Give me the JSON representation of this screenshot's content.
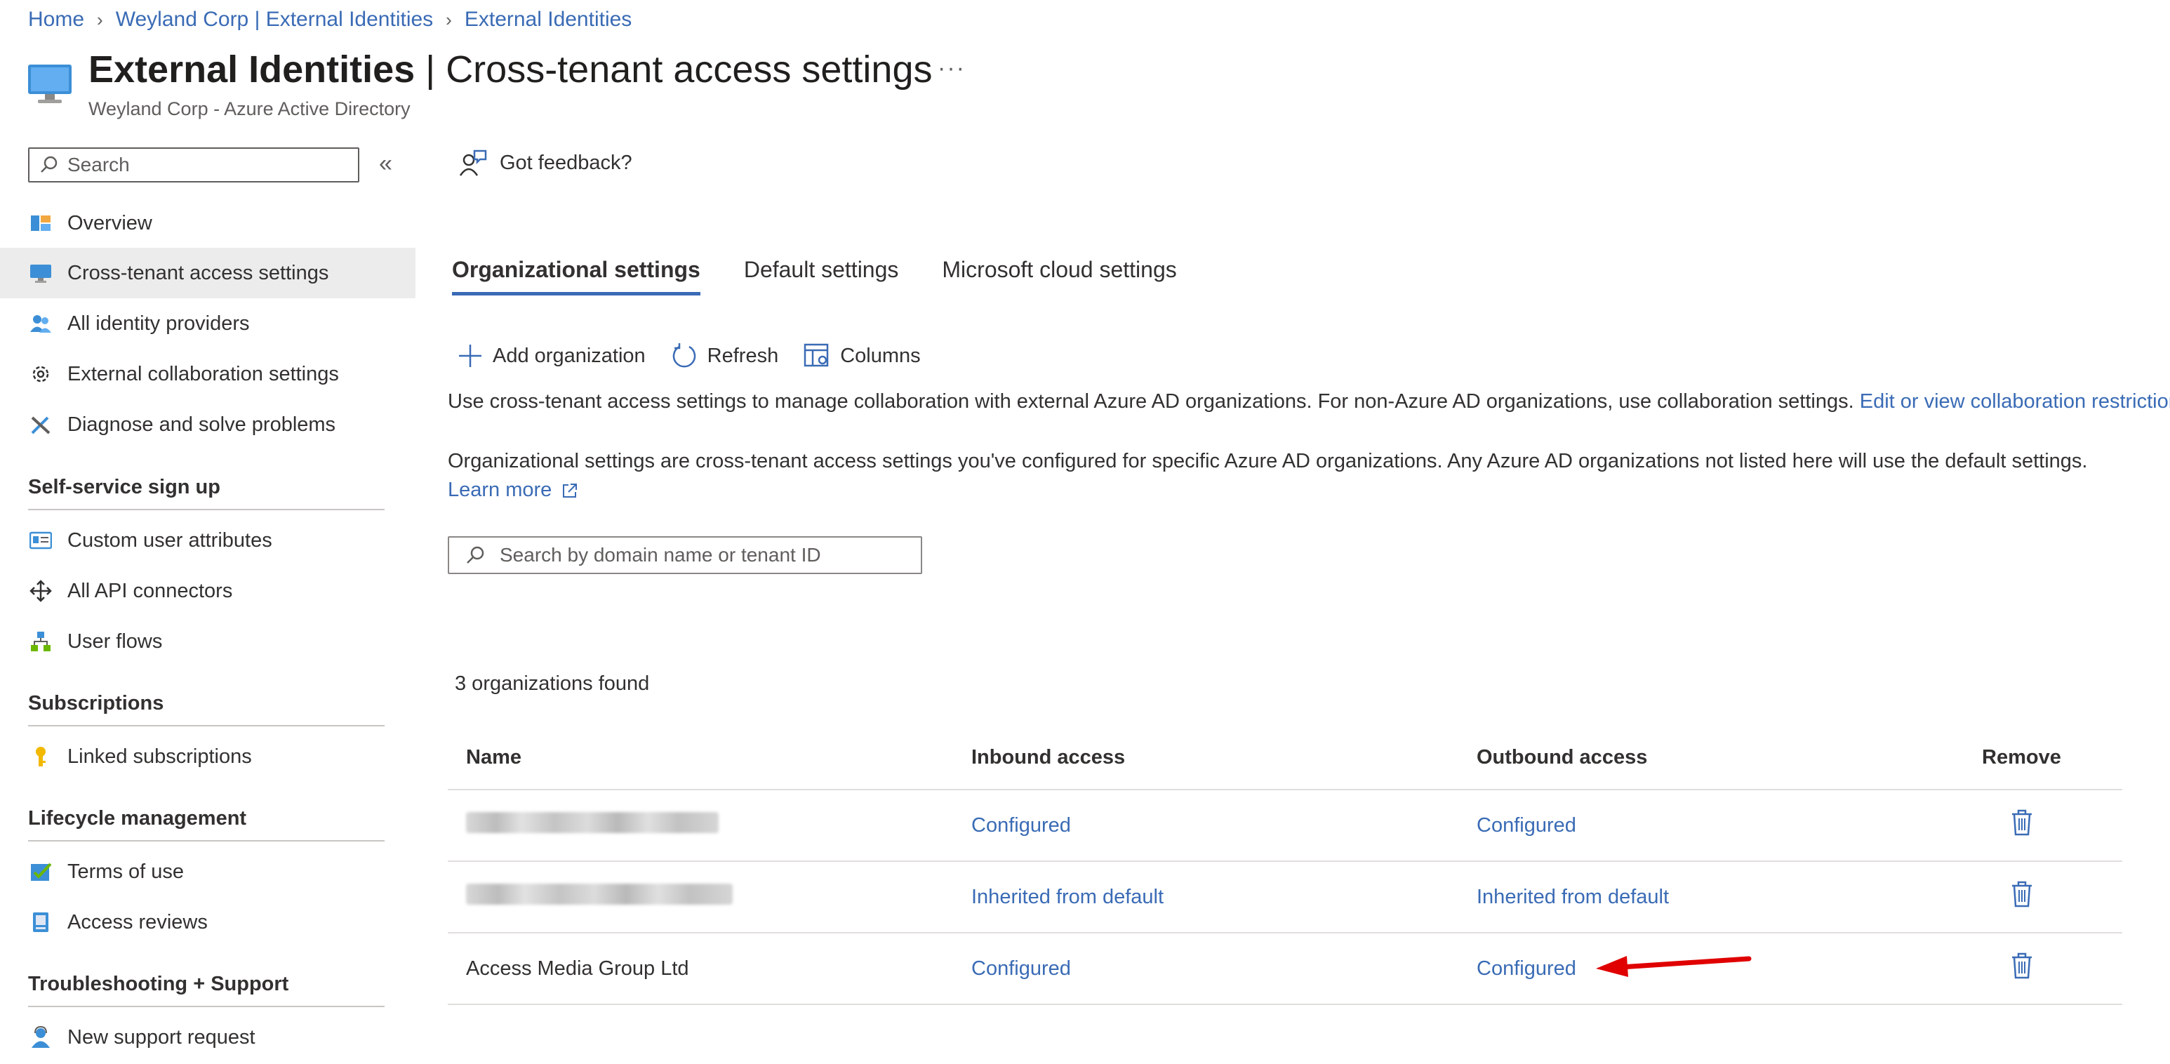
{
  "breadcrumb": {
    "items": [
      "Home",
      "Weyland Corp | External Identities",
      "External Identities"
    ]
  },
  "header": {
    "title_bold": "External Identities",
    "title_rest": " | Cross-tenant access settings",
    "more": "···",
    "subtitle": "Weyland Corp - Azure Active Directory"
  },
  "sidebar": {
    "search_placeholder": "Search",
    "collapse": "«",
    "items": [
      {
        "label": "Overview",
        "icon": "overview-icon"
      },
      {
        "label": "Cross-tenant access settings",
        "icon": "monitor-icon",
        "active": true
      },
      {
        "label": "All identity providers",
        "icon": "users-icon"
      },
      {
        "label": "External collaboration settings",
        "icon": "gear-icon"
      },
      {
        "label": "Diagnose and solve problems",
        "icon": "wrench-icon"
      }
    ],
    "sections": [
      {
        "title": "Self-service sign up",
        "items": [
          "Custom user attributes",
          "All API connectors",
          "User flows"
        ]
      },
      {
        "title": "Subscriptions",
        "items": [
          "Linked subscriptions"
        ]
      },
      {
        "title": "Lifecycle management",
        "items": [
          "Terms of use",
          "Access reviews"
        ]
      },
      {
        "title": "Troubleshooting + Support",
        "items": [
          "New support request"
        ]
      }
    ]
  },
  "main": {
    "feedback": "Got feedback?",
    "tabs": [
      "Organizational settings",
      "Default settings",
      "Microsoft cloud settings"
    ],
    "commands": [
      "Add organization",
      "Refresh",
      "Columns"
    ],
    "desc1_text": "Use cross-tenant access settings to manage collaboration with external Azure AD organizations. For non-Azure AD organizations, use collaboration settings. ",
    "desc1_link": "Edit or view collaboration restrictions",
    "desc2": "Organizational settings are cross-tenant access settings you've configured for specific Azure AD organizations. Any Azure AD organizations not listed here will use the default settings.",
    "learn_more": "Learn more",
    "org_search_placeholder": "Search by domain name or tenant ID",
    "count": "3 organizations found",
    "table": {
      "headers": [
        "Name",
        "Inbound access",
        "Outbound access",
        "Remove"
      ],
      "rows": [
        {
          "name": "",
          "inbound": "Configured",
          "outbound": "Configured"
        },
        {
          "name": "",
          "inbound": "Inherited from default",
          "outbound": "Inherited from default"
        },
        {
          "name": "Access Media Group Ltd",
          "inbound": "Configured",
          "outbound": "Configured"
        }
      ]
    }
  },
  "colors": {
    "accent": "#3a6bb5",
    "arrow": "#e00000",
    "active_nav_bg": "#ececec"
  }
}
